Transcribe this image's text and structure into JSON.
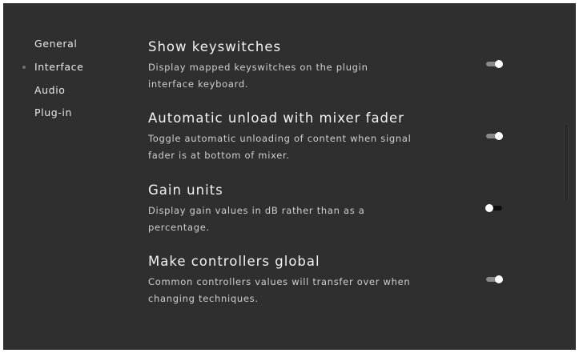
{
  "sidebar": {
    "items": [
      {
        "label": "General",
        "active": false
      },
      {
        "label": "Interface",
        "active": true
      },
      {
        "label": "Audio",
        "active": false
      },
      {
        "label": "Plug-in",
        "active": false
      }
    ]
  },
  "settings": [
    {
      "title": "Show keyswitches",
      "description": "Display mapped keyswitches on the plugin interface keyboard.",
      "toggle_on": true
    },
    {
      "title": "Automatic unload with mixer fader",
      "description": "Toggle automatic unloading of content when signal fader is at bottom of mixer.",
      "toggle_on": true
    },
    {
      "title": "Gain units",
      "description": "Display gain values in dB rather than as a percentage.",
      "toggle_on": false
    },
    {
      "title": "Make controllers global",
      "description": "Common controllers values will transfer over when changing techniques.",
      "toggle_on": true
    }
  ],
  "colors": {
    "background": "#2f2f2f",
    "text": "#f2f2f2",
    "toggle_track_on": "#8a8a8a",
    "toggle_track_off": "#0e0e0e"
  }
}
